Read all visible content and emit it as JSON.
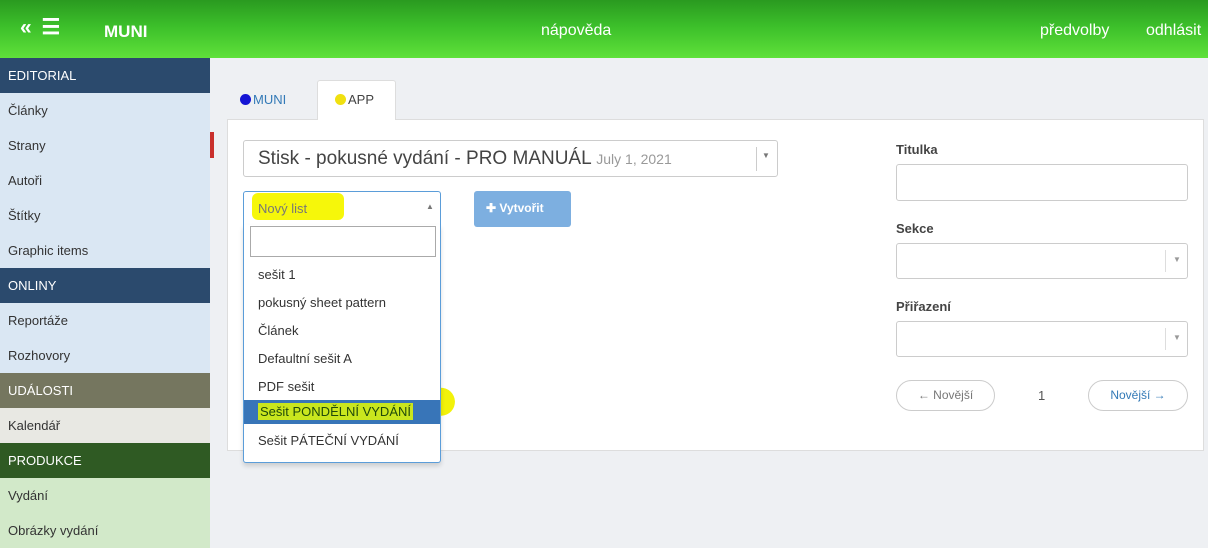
{
  "topbar": {
    "menu_icon": "« ☰",
    "brand": "MUNI",
    "help": "nápověda",
    "preferences": "předvolby",
    "logout": "odhlásit"
  },
  "sidebar": {
    "sections": [
      {
        "header": "EDITORIAL",
        "items": [
          "Články",
          "Strany",
          "Autoři",
          "Štítky",
          "Graphic items"
        ]
      },
      {
        "header": "ONLINY",
        "items": [
          "Reportáže",
          "Rozhovory"
        ]
      },
      {
        "header": "UDÁLOSTI",
        "items": [
          "Kalendář"
        ]
      },
      {
        "header": "PRODUKCE",
        "items": [
          "Vydání",
          "Obrázky vydání"
        ]
      }
    ],
    "active_item": "Strany"
  },
  "tabs": {
    "muni": {
      "label": "MUNI",
      "dot_color": "#1414d4"
    },
    "app": {
      "label": "APP",
      "dot_color": "#f0e010"
    }
  },
  "issue_select": {
    "title": "Stisk - pokusné vydání - PRO MANUÁL",
    "date": "July 1, 2021"
  },
  "sheet_select": {
    "value": "Nový list",
    "search_value": "",
    "options": [
      "sešit 1",
      "pokusný sheet pattern",
      "Článek",
      "Defaultní sešit A",
      "PDF sešit",
      "Sešit PONDĚLNÍ VYDÁNÍ",
      "Sešit PÁTEČNÍ VYDÁNÍ"
    ],
    "highlighted_option": "Sešit PONDĚLNÍ VYDÁNÍ"
  },
  "create_button": {
    "label": "Vytvořit",
    "icon": "plus-icon"
  },
  "form": {
    "title_label": "Titulka",
    "title_value": "",
    "section_label": "Sekce",
    "assign_label": "Přiřazení"
  },
  "pager": {
    "prev": "← Novější",
    "page": "1",
    "next": "Novější →"
  },
  "colors": {
    "topbar": "#3cbf2a",
    "editorial": "#2b4a6d",
    "udalosti": "#75765f",
    "produkce": "#2f5a23",
    "selected_option": "#3875b8",
    "highlighter": "#f6f70a"
  }
}
